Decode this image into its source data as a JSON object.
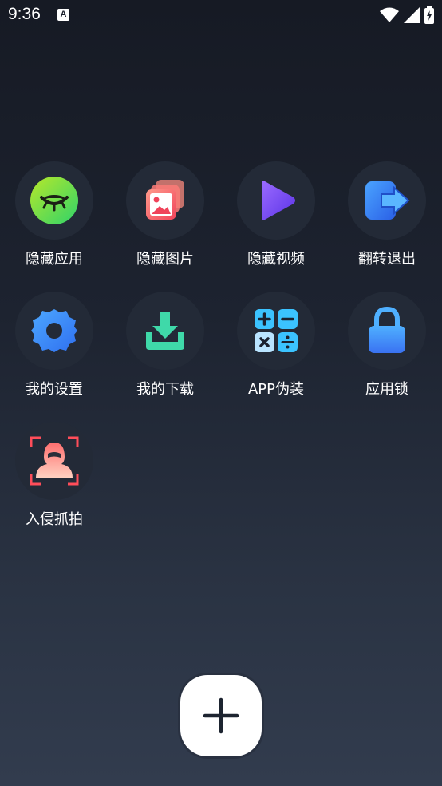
{
  "status_bar": {
    "time": "9:36",
    "notification_icon_letter": "A",
    "icons": [
      "wifi-icon",
      "signal-icon",
      "battery-icon"
    ]
  },
  "tiles": [
    {
      "label": "隐藏应用",
      "icon": "eye-closed-icon",
      "color": "#7ed321"
    },
    {
      "label": "隐藏图片",
      "icon": "gallery-icon",
      "color": "#f0505a"
    },
    {
      "label": "隐藏视频",
      "icon": "play-icon",
      "color": "#7b4dff"
    },
    {
      "label": "翻转退出",
      "icon": "exit-icon",
      "color": "#2f7dff"
    },
    {
      "label": "我的设置",
      "icon": "gear-icon",
      "color": "#3b8cff"
    },
    {
      "label": "我的下载",
      "icon": "download-icon",
      "color": "#3fd9a9"
    },
    {
      "label": "APP伪装",
      "icon": "calculator-icon",
      "color": "#2ab4ff"
    },
    {
      "label": "应用锁",
      "icon": "lock-icon",
      "color": "#3d8bff"
    },
    {
      "label": "入侵抓拍",
      "icon": "intruder-icon",
      "color": "#ff5a5f"
    }
  ],
  "fab": {
    "icon": "plus-icon"
  }
}
